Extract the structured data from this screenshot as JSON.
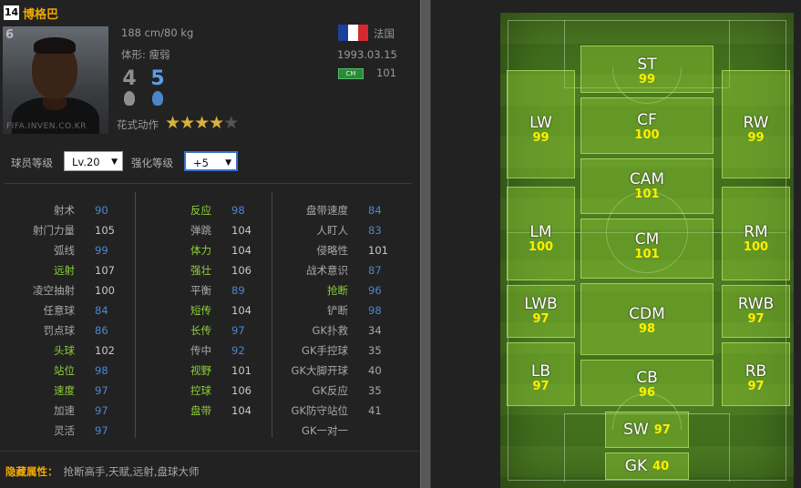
{
  "player": {
    "season_badge": "14",
    "name": "博格巴",
    "overall": "6",
    "photo_watermark": "FIFA.INVEN.CO.KR",
    "height_weight": "188 cm/80 kg",
    "body_type": "体形: 瘦弱",
    "foot_left": "4",
    "foot_right": "5",
    "skill_label": "花式动作",
    "skill_stars": 4,
    "skill_stars_max": 5,
    "nation": "法国",
    "birth": "1993.03.15",
    "position_badge": "CM",
    "position_value": "101"
  },
  "controls": {
    "level_label": "球员等级",
    "level_value": "Lv.20",
    "enhance_label": "强化等级",
    "enhance_value": "+5"
  },
  "stats": {
    "col1": [
      {
        "name": "射术",
        "value": "90",
        "name_color": "gray",
        "value_color": "blue"
      },
      {
        "name": "射门力量",
        "value": "105",
        "name_color": "gray",
        "value_color": "lgray"
      },
      {
        "name": "弧线",
        "value": "99",
        "name_color": "gray",
        "value_color": "blue"
      },
      {
        "name": "远射",
        "value": "107",
        "name_color": "green",
        "value_color": "lgray"
      },
      {
        "name": "凌空抽射",
        "value": "100",
        "name_color": "gray",
        "value_color": "lgray"
      },
      {
        "name": "任意球",
        "value": "84",
        "name_color": "gray",
        "value_color": "blue"
      },
      {
        "name": "罚点球",
        "value": "86",
        "name_color": "gray",
        "value_color": "blue"
      },
      {
        "name": "头球",
        "value": "102",
        "name_color": "green",
        "value_color": "lgray"
      },
      {
        "name": "站位",
        "value": "98",
        "name_color": "green",
        "value_color": "blue"
      },
      {
        "name": "速度",
        "value": "97",
        "name_color": "green",
        "value_color": "blue"
      },
      {
        "name": "加速",
        "value": "97",
        "name_color": "gray",
        "value_color": "blue"
      },
      {
        "name": "灵活",
        "value": "97",
        "name_color": "gray",
        "value_color": "blue"
      }
    ],
    "col2": [
      {
        "name": "反应",
        "value": "98",
        "name_color": "green",
        "value_color": "blue"
      },
      {
        "name": "弹跳",
        "value": "104",
        "name_color": "gray",
        "value_color": "lgray"
      },
      {
        "name": "体力",
        "value": "104",
        "name_color": "green",
        "value_color": "lgray"
      },
      {
        "name": "强壮",
        "value": "106",
        "name_color": "green",
        "value_color": "lgray"
      },
      {
        "name": "平衡",
        "value": "89",
        "name_color": "gray",
        "value_color": "blue"
      },
      {
        "name": "短传",
        "value": "104",
        "name_color": "green",
        "value_color": "lgray"
      },
      {
        "name": "长传",
        "value": "97",
        "name_color": "green",
        "value_color": "blue"
      },
      {
        "name": "传中",
        "value": "92",
        "name_color": "gray",
        "value_color": "blue"
      },
      {
        "name": "视野",
        "value": "101",
        "name_color": "green",
        "value_color": "lgray"
      },
      {
        "name": "控球",
        "value": "106",
        "name_color": "green",
        "value_color": "lgray"
      },
      {
        "name": "盘带",
        "value": "104",
        "name_color": "green",
        "value_color": "lgray"
      }
    ],
    "col3": [
      {
        "name": "盘带速度",
        "value": "84",
        "name_color": "gray",
        "value_color": "blue"
      },
      {
        "name": "人盯人",
        "value": "83",
        "name_color": "gray",
        "value_color": "blue"
      },
      {
        "name": "侵略性",
        "value": "101",
        "name_color": "gray",
        "value_color": "lgray"
      },
      {
        "name": "战术意识",
        "value": "87",
        "name_color": "gray",
        "value_color": "blue"
      },
      {
        "name": "抢断",
        "value": "96",
        "name_color": "green",
        "value_color": "blue"
      },
      {
        "name": "铲断",
        "value": "98",
        "name_color": "gray",
        "value_color": "blue"
      },
      {
        "name": "GK扑救",
        "value": "34",
        "name_color": "gray",
        "value_color": "gray"
      },
      {
        "name": "GK手控球",
        "value": "35",
        "name_color": "gray",
        "value_color": "gray"
      },
      {
        "name": "GK大脚开球",
        "value": "40",
        "name_color": "gray",
        "value_color": "gray"
      },
      {
        "name": "GK反应",
        "value": "35",
        "name_color": "gray",
        "value_color": "gray"
      },
      {
        "name": "GK防守站位",
        "value": "41",
        "name_color": "gray",
        "value_color": "gray"
      },
      {
        "name": "GK一对一",
        "value": "",
        "name_color": "gray",
        "value_color": "gray"
      }
    ]
  },
  "hidden": {
    "label": "隐藏属性：",
    "value": "抢断高手,天赋,远射,盘球大师"
  },
  "positions": {
    "ST": {
      "label": "ST",
      "rating": "99"
    },
    "LW": {
      "label": "LW",
      "rating": "99"
    },
    "CF": {
      "label": "CF",
      "rating": "100"
    },
    "RW": {
      "label": "RW",
      "rating": "99"
    },
    "CAM": {
      "label": "CAM",
      "rating": "101"
    },
    "LM": {
      "label": "LM",
      "rating": "100"
    },
    "CM": {
      "label": "CM",
      "rating": "101"
    },
    "RM": {
      "label": "RM",
      "rating": "100"
    },
    "LWB": {
      "label": "LWB",
      "rating": "97"
    },
    "CDM": {
      "label": "CDM",
      "rating": "98"
    },
    "RWB": {
      "label": "RWB",
      "rating": "97"
    },
    "LB": {
      "label": "LB",
      "rating": "97"
    },
    "CB": {
      "label": "CB",
      "rating": "96"
    },
    "RB": {
      "label": "RB",
      "rating": "97"
    },
    "SW": {
      "label": "SW",
      "rating": "97"
    },
    "GK": {
      "label": "GK",
      "rating": "40"
    }
  },
  "colors": {
    "name": "#f0a800",
    "green_stat": "#8ecf3b",
    "blue_value": "#4b86d6",
    "rating_yellow": "#ffee00",
    "flag": [
      "#1d3e9a",
      "#ffffff",
      "#d42a2f"
    ]
  }
}
